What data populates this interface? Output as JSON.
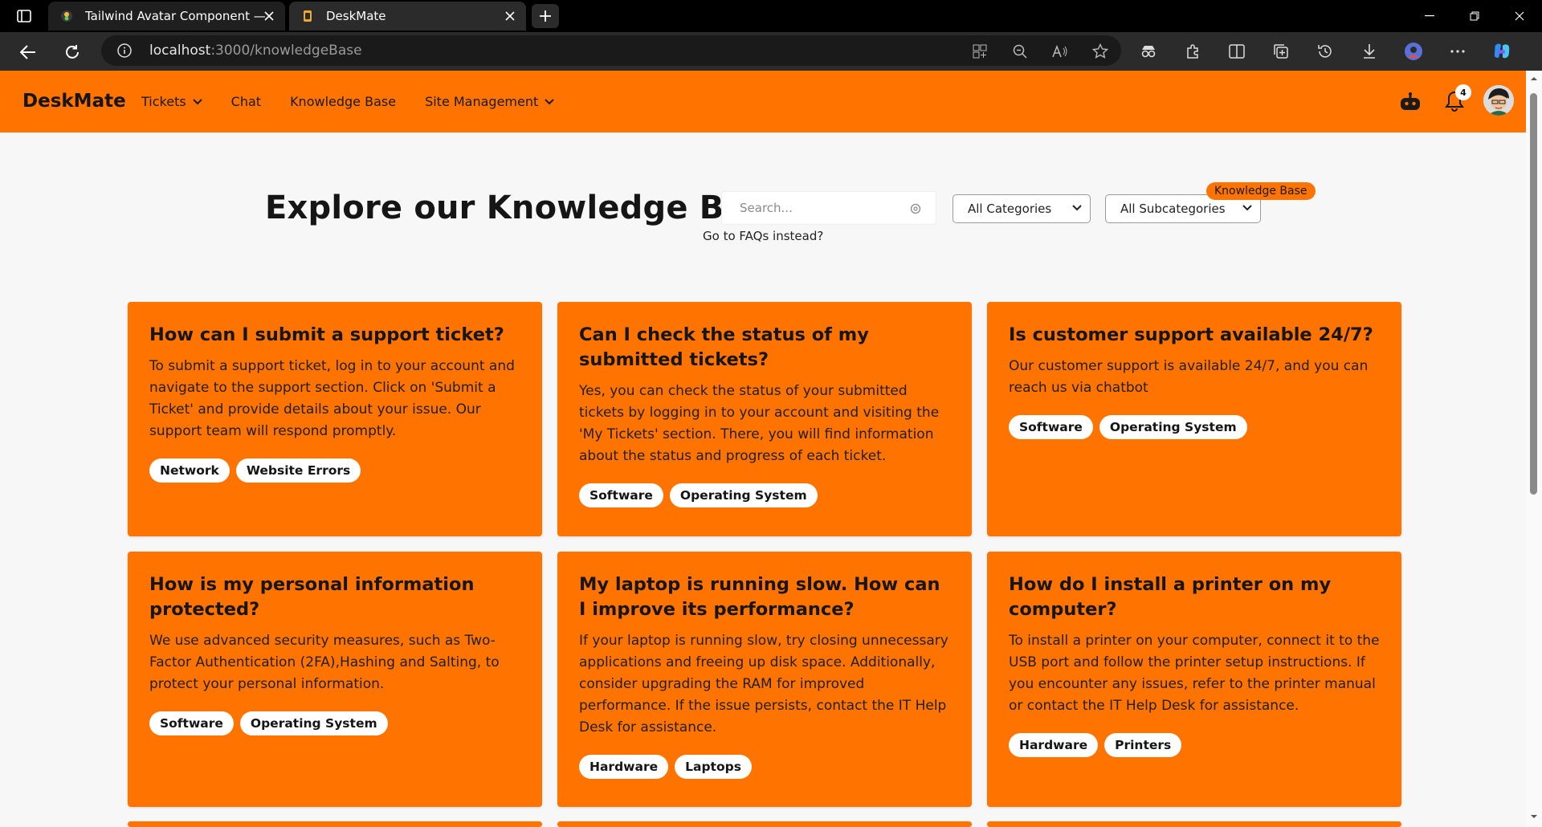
{
  "browser": {
    "tabs": [
      {
        "title": "Tailwind Avatar Component — Tailwind",
        "active": false
      },
      {
        "title": "DeskMate",
        "active": true
      }
    ],
    "url_host": "localhost",
    "url_path": ":3000/knowledgeBase"
  },
  "navbar": {
    "brand": "DeskMate",
    "menu": [
      {
        "label": "Tickets",
        "dropdown": true
      },
      {
        "label": "Chat",
        "dropdown": false
      },
      {
        "label": "Knowledge Base",
        "dropdown": false
      },
      {
        "label": "Site Management",
        "dropdown": true
      }
    ],
    "notification_count": "4"
  },
  "hero": {
    "title": "Explore our Knowledge Base",
    "search_placeholder": "Search...",
    "category_select": "All Categories",
    "subcategory_select": "All Subcategories",
    "section_chip": "Knowledge Base",
    "faq_link": "Go to FAQs instead?"
  },
  "cards": [
    {
      "title": "How can I submit a support ticket?",
      "body": "To submit a support ticket, log in to your account and navigate to the support section. Click on 'Submit a Ticket' and provide details about your issue. Our support team will respond promptly.",
      "tags": [
        "Network",
        "Website Errors"
      ]
    },
    {
      "title": "Can I check the status of my submitted tickets?",
      "body": "Yes, you can check the status of your submitted tickets by logging in to your account and visiting the 'My Tickets' section. There, you will find information about the status and progress of each ticket.",
      "tags": [
        "Software",
        "Operating System"
      ]
    },
    {
      "title": "Is customer support available 24/7?",
      "body": "Our customer support is available 24/7, and you can reach us via chatbot",
      "tags": [
        "Software",
        "Operating System"
      ]
    },
    {
      "title": "How is my personal information protected?",
      "body": "We use advanced security measures, such as Two-Factor Authentication (2FA),Hashing and Salting, to protect your personal information.",
      "tags": [
        "Software",
        "Operating System"
      ]
    },
    {
      "title": "My laptop is running slow. How can I improve its performance?",
      "body": "If your laptop is running slow, try closing unnecessary applications and freeing up disk space. Additionally, consider upgrading the RAM for improved performance. If the issue persists, contact the IT Help Desk for assistance.",
      "tags": [
        "Hardware",
        "Laptops"
      ]
    },
    {
      "title": "How do I install a printer on my computer?",
      "body": "To install a printer on your computer, connect it to the USB port and follow the printer setup instructions. If you encounter any issues, refer to the printer manual or contact the IT Help Desk for assistance.",
      "tags": [
        "Hardware",
        "Printers"
      ]
    }
  ],
  "colors": {
    "brand_orange": "#ff7300",
    "page_bg": "#f7f7f7",
    "browser_chrome": "#2b2b2b"
  }
}
